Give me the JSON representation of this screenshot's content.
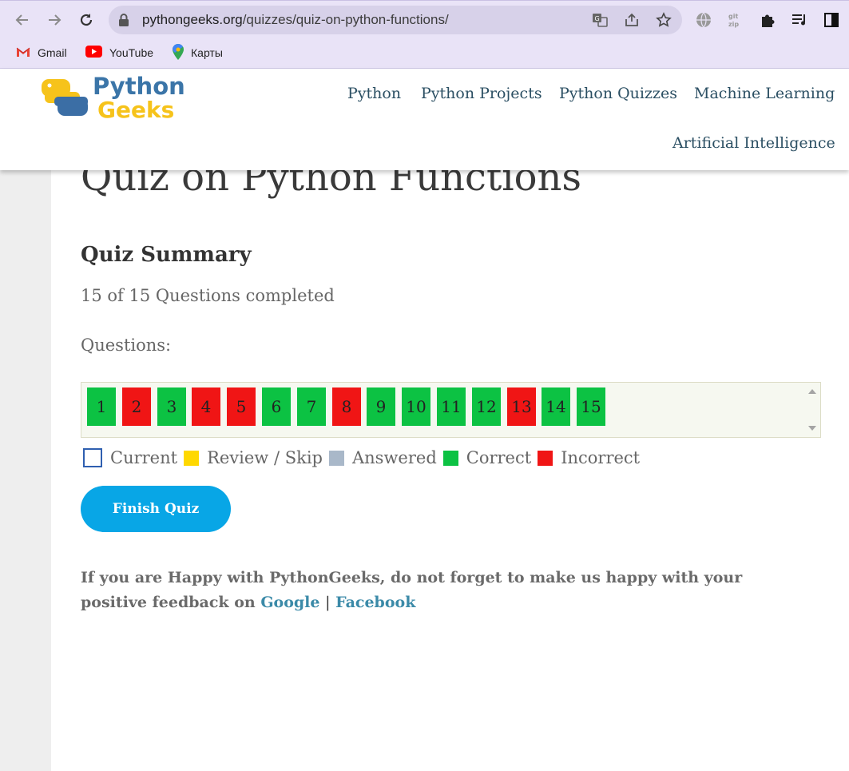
{
  "browser": {
    "url_host": "pythongeeks.org",
    "url_path": "/quizzes/quiz-on-python-functions/",
    "bookmarks": [
      {
        "label": "Gmail",
        "icon": "gmail-icon"
      },
      {
        "label": "YouTube",
        "icon": "youtube-icon"
      },
      {
        "label": "Карты",
        "icon": "maps-icon"
      }
    ]
  },
  "site": {
    "logo_line1": "Python",
    "logo_line2": "Geeks",
    "nav": [
      "Python",
      "Python Projects",
      "Python Quizzes",
      "Machine Learning",
      "Artificial Intelligence"
    ]
  },
  "quiz": {
    "title": "Quiz on Python Functions",
    "summary_heading": "Quiz Summary",
    "completed_text": "15 of 15 Questions completed",
    "questions_label": "Questions:",
    "questions": [
      {
        "n": "1",
        "status": "correct"
      },
      {
        "n": "2",
        "status": "incorrect"
      },
      {
        "n": "3",
        "status": "correct"
      },
      {
        "n": "4",
        "status": "incorrect"
      },
      {
        "n": "5",
        "status": "incorrect"
      },
      {
        "n": "6",
        "status": "correct"
      },
      {
        "n": "7",
        "status": "correct"
      },
      {
        "n": "8",
        "status": "incorrect"
      },
      {
        "n": "9",
        "status": "correct"
      },
      {
        "n": "10",
        "status": "correct"
      },
      {
        "n": "11",
        "status": "correct"
      },
      {
        "n": "12",
        "status": "correct"
      },
      {
        "n": "13",
        "status": "incorrect"
      },
      {
        "n": "14",
        "status": "correct"
      },
      {
        "n": "15",
        "status": "correct"
      }
    ],
    "legend": {
      "current": "Current",
      "review": "Review / Skip",
      "answered": "Answered",
      "correct": "Correct",
      "incorrect": "Incorrect"
    },
    "finish_button": "Finish Quiz"
  },
  "feedback": {
    "text": "If you are Happy with PythonGeeks, do not forget to make us happy with your positive feedback on",
    "google": "Google",
    "separator": "|",
    "facebook": "Facebook"
  },
  "colors": {
    "correct": "#0cc243",
    "incorrect": "#f01515",
    "review": "#ffd800",
    "answered": "#a9b8c9",
    "button": "#08a6e6"
  }
}
